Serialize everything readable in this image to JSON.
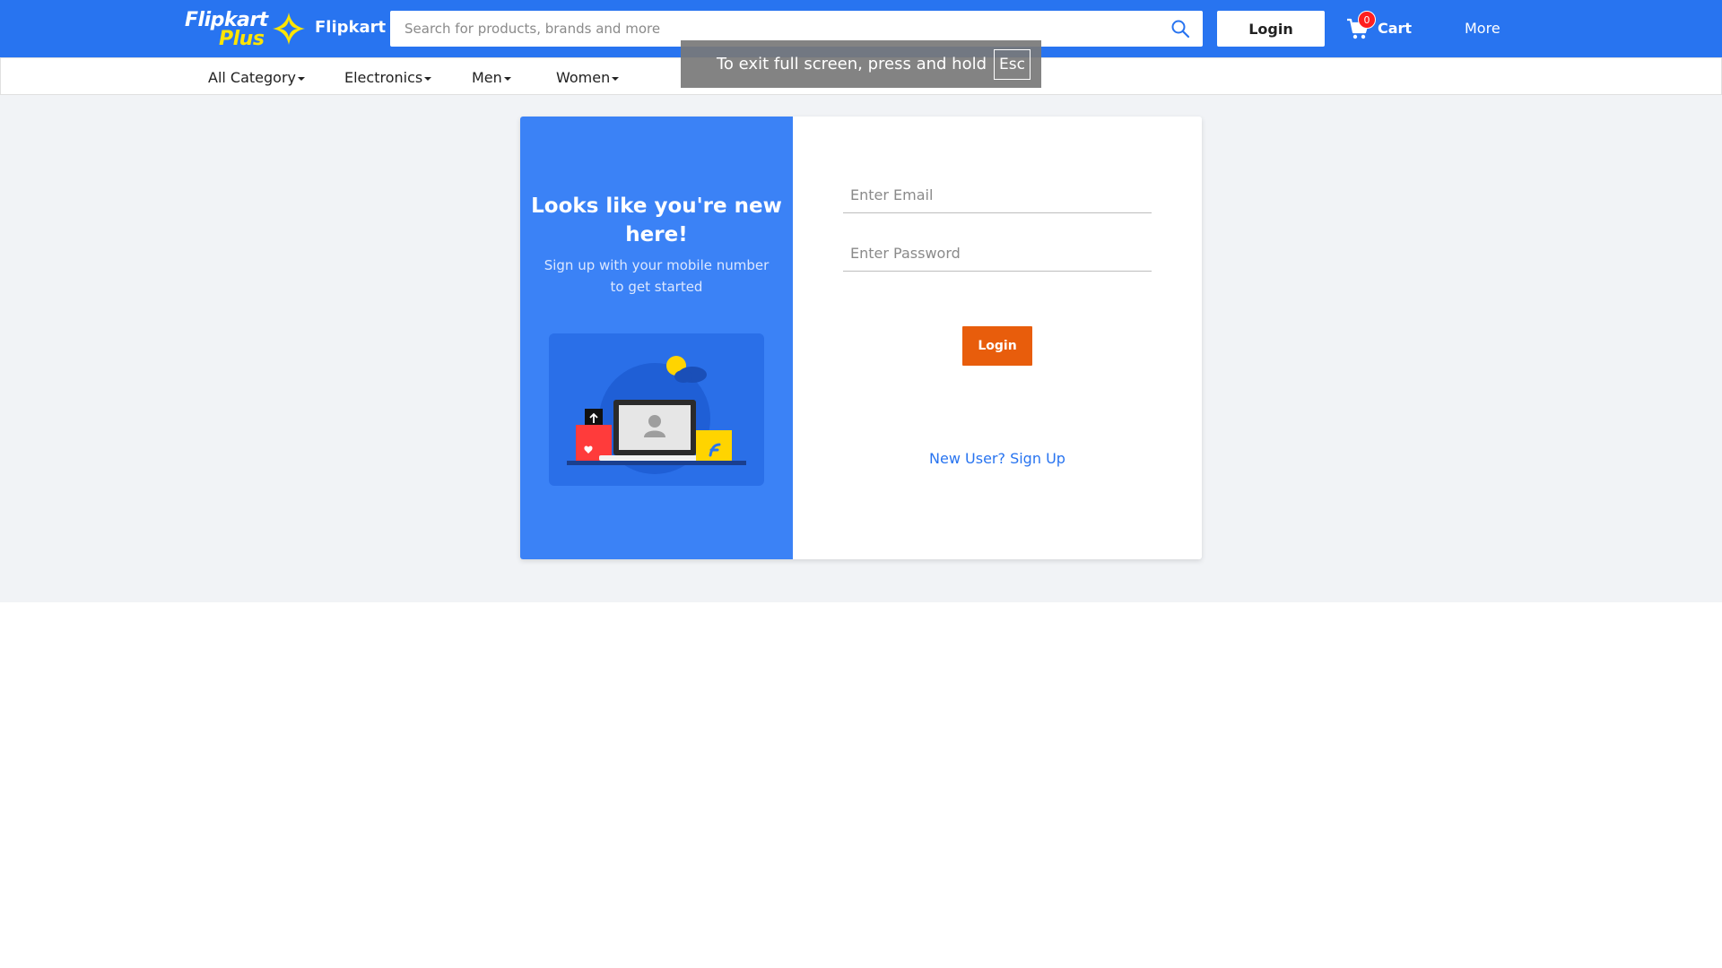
{
  "header": {
    "logo": {
      "word1": "Flipkart",
      "word2": "Plus"
    },
    "brand_name": "Flipkart",
    "search_placeholder": "Search for products, brands and more",
    "login_label": "Login",
    "cart": {
      "label": "Cart",
      "count": "0"
    },
    "more_label": "More",
    "colors": {
      "bar": "#2874f0",
      "logo_accent": "#ffe500"
    }
  },
  "categories": [
    {
      "label": "All Category"
    },
    {
      "label": "Electronics"
    },
    {
      "label": "Men"
    },
    {
      "label": "Women"
    }
  ],
  "fullscreen_toast": {
    "text": "To exit full screen, press and hold",
    "key": "Esc"
  },
  "login_card": {
    "left": {
      "title": "Looks like you're new here!",
      "subtitle": "Sign up with your mobile number to get started",
      "illustration": "laptop-user-illustration"
    },
    "form": {
      "email_placeholder": "Enter Email",
      "password_placeholder": "Enter Password",
      "submit_label": "Login",
      "signup_link": "New User? Sign Up"
    },
    "colors": {
      "left_panel": "#3b82f6",
      "submit": "#e85d0c",
      "link": "#2874f0"
    }
  }
}
